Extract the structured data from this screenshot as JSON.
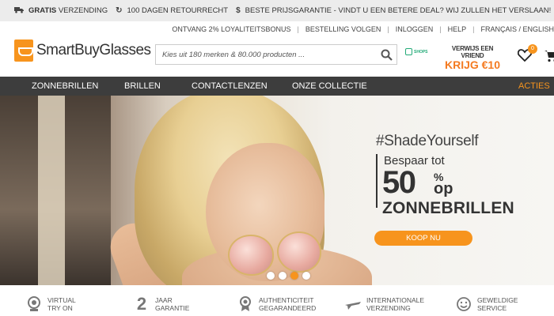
{
  "topbar": {
    "usps": [
      {
        "icon": "truck-icon",
        "label_bold": "Gratis",
        "label": "verzending"
      },
      {
        "icon": "refresh-icon",
        "label_bold": "",
        "label": "100 dagen retourrecht"
      },
      {
        "icon": "dollar-icon",
        "label_bold": "",
        "label": "Beste prijsgarantie - vindt u een betere deal? wij zullen het verslaan!"
      }
    ]
  },
  "utility": {
    "links": [
      "ONTVANG 2% LOYALITEITSBONUS",
      "BESTELLING VOLGEN",
      "INLOGGEN",
      "HELP",
      "FRANÇAIS / ENGLISH"
    ]
  },
  "logo": {
    "text": "SmartBuyGlasses",
    "color": "#f7941d"
  },
  "search": {
    "placeholder": "Kies uit 180 merken & 80.000 producten ...",
    "value": ""
  },
  "shops_badge": {
    "text": "SHOPS"
  },
  "refer": {
    "line1": "VERWIJS EEN VRIEND",
    "line2": "KRIJG €10"
  },
  "wishlist": {
    "count": "0"
  },
  "nav": {
    "items": [
      "ZONNEBRILLEN",
      "BRILLEN",
      "CONTACTLENZEN",
      "ONZE COLLECTIE"
    ],
    "promo_item": "ACTIES",
    "accent": "#f7941d"
  },
  "hero": {
    "hashtag": "#ShadeYourself",
    "line1": "Bespaar tot",
    "big_number": "50",
    "percent": "%",
    "op": "op",
    "product": "ZONNEBRILLEN",
    "cta": "KOOP NU",
    "slides_count": 4,
    "active_slide": 3
  },
  "features": [
    {
      "icon": "webcam-icon",
      "line1": "VIRTUAL",
      "line2": "TRY ON"
    },
    {
      "icon": "two-icon",
      "line1": "JAAR",
      "line2": "GARANTIE"
    },
    {
      "icon": "medal-icon",
      "line1": "AUTHENTICITEIT",
      "line2": "GEGARANDEERD"
    },
    {
      "icon": "plane-icon",
      "line1": "INTERNATIONALE",
      "line2": "VERZENDING"
    },
    {
      "icon": "smiley-icon",
      "line1": "GEWELDIGE",
      "line2": "SERVICE"
    }
  ]
}
